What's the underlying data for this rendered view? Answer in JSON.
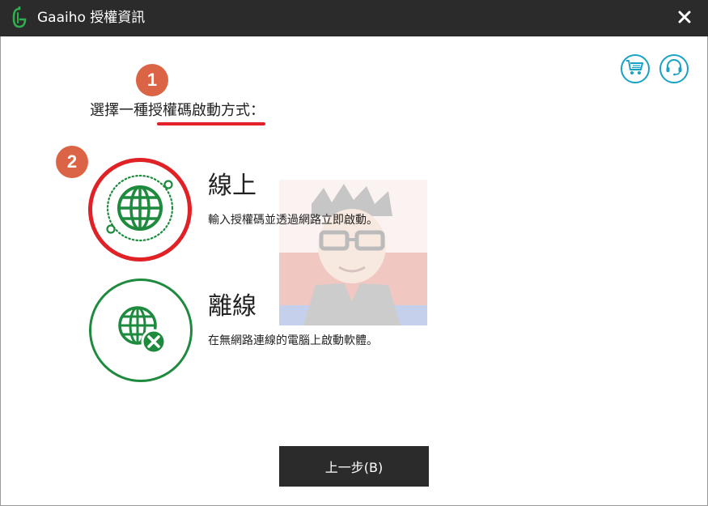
{
  "titlebar": {
    "title": "Gaaiho 授權資訊",
    "logo_icon": "gaaiho-logo-icon",
    "close_icon": "close-icon"
  },
  "toolbar": {
    "cart_icon": "shopping-cart-icon",
    "support_icon": "headset-icon"
  },
  "steps": {
    "step1": "1",
    "step2": "2"
  },
  "instruction": "選擇一種授權碼啟動方式：",
  "options": [
    {
      "title": "線上",
      "description": "輸入授權碼並透過網路立即啟動。",
      "icon": "globe-online-icon"
    },
    {
      "title": "離線",
      "description": "在無網路連線的電腦上啟動軟體。",
      "icon": "globe-offline-icon"
    }
  ],
  "back_button": {
    "label": "上一步(B)"
  },
  "colors": {
    "titlebar": "#2b2b2b",
    "accent_green": "#1e8a3e",
    "selected_red": "#e02227",
    "badge_orange": "#dc6446",
    "toolbar_blue": "#1aa1c6"
  }
}
